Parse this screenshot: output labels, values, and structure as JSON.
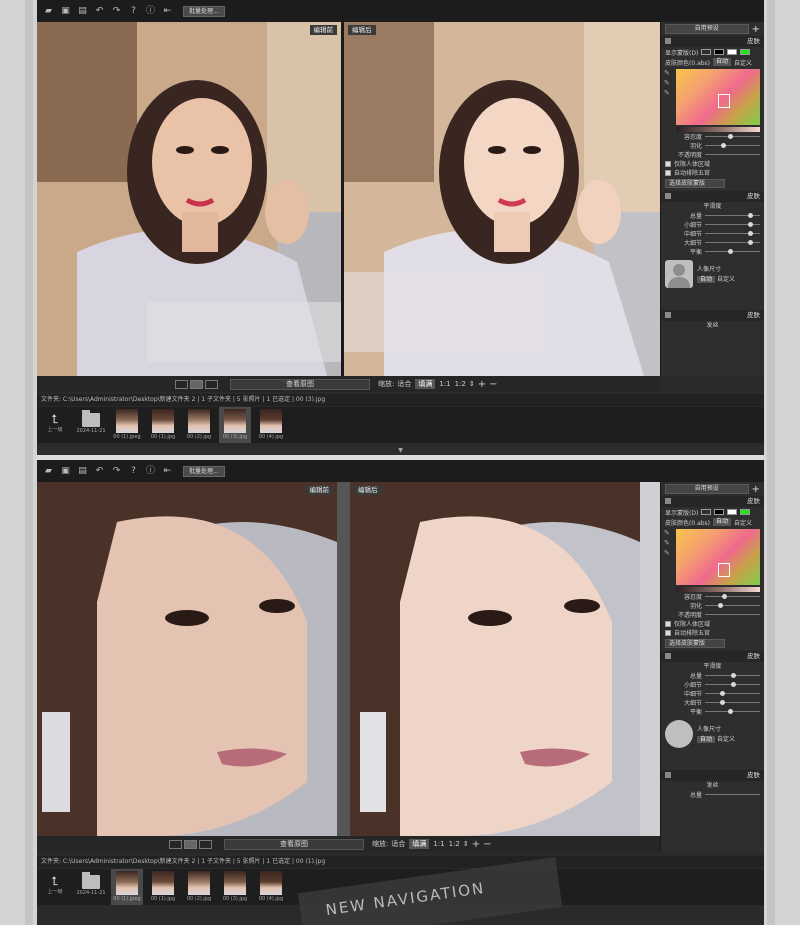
{
  "toolbar": {
    "batch_label": "批量处理..."
  },
  "top": {
    "before_label": "编辑前",
    "after_label": "编辑后",
    "view_original": "查看原图",
    "zoom_label": "缩放:",
    "fit": "适合",
    "fill": "填满",
    "ratio_1": "1:1",
    "ratio_2": "1:2",
    "path": "文件夹: C:\\Users\\Administrator\\Desktop\\新建文件夹 2 | 1 子文件夹 | 5 张照片 | 1 已选定 | 00 (3).jpg",
    "thumbs": [
      {
        "label": "上一级",
        "kind": "up"
      },
      {
        "label": "2024-11-21",
        "kind": "folder"
      },
      {
        "label": "00 (1).jpeg",
        "kind": "img"
      },
      {
        "label": "00 (1).jpg",
        "kind": "img"
      },
      {
        "label": "00 (2).jpg",
        "kind": "img"
      },
      {
        "label": "00 (3).jpg",
        "kind": "img",
        "selected": true
      },
      {
        "label": "00 (4).jpg",
        "kind": "img"
      }
    ]
  },
  "bottom": {
    "before_label": "编辑前",
    "after_label": "编辑后",
    "view_original": "查看原图",
    "zoom_label": "缩放:",
    "fit": "适合",
    "fill": "填满",
    "ratio_1": "1:1",
    "ratio_2": "1:2",
    "path": "文件夹: C:\\Users\\Administrator\\Desktop\\新建文件夹 2 | 1 子文件夹 | 5 张照片 | 1 已选定 | 00 (1).jpg",
    "thumbs": [
      {
        "label": "上一级",
        "kind": "up"
      },
      {
        "label": "2024-11-21",
        "kind": "folder"
      },
      {
        "label": "00 (1).jpeg",
        "kind": "img",
        "selected": true
      },
      {
        "label": "00 (1).jpg",
        "kind": "img"
      },
      {
        "label": "00 (2).jpg",
        "kind": "img"
      },
      {
        "label": "00 (3).jpg",
        "kind": "img"
      },
      {
        "label": "00 (4).jpg",
        "kind": "img"
      }
    ]
  },
  "panel": {
    "preset": "自用预设",
    "skin_section": "皮肤",
    "show_mask": "显示蒙版(D)",
    "skin_color": "皮肤颜色(0.abs)",
    "auto": "自动",
    "custom": "自定义",
    "tolerance": "容忍度",
    "feather": "羽化",
    "opacity": "不透明度",
    "only_body": "仅限人体区域",
    "auto_remove": "自动排除五官",
    "select_skin": "选择皮肤蒙版",
    "skin_smooth": "皮肤",
    "smooth": "平滑度",
    "overall": "总量",
    "small_detail": "小细节",
    "mid_detail": "中细节",
    "large_detail": "大细节",
    "balance": "平衡",
    "face_size": "人像尺寸",
    "skin_tone": "皮肤",
    "hair_ctrl": "发丝",
    "bottom_overall": "总量",
    "skin_sliders": [
      0.45,
      0.32
    ],
    "smooth_sliders": [
      0.82,
      0.82,
      0.82,
      0.82,
      0.45
    ],
    "skin_sliders_b": [
      0.35,
      0.28
    ],
    "smooth_sliders_b": [
      0.5,
      0.5,
      0.3,
      0.3,
      0.45
    ]
  },
  "watermark": "NEW NAVIGATION",
  "colors": {
    "accent_green": "#1fe61f"
  }
}
